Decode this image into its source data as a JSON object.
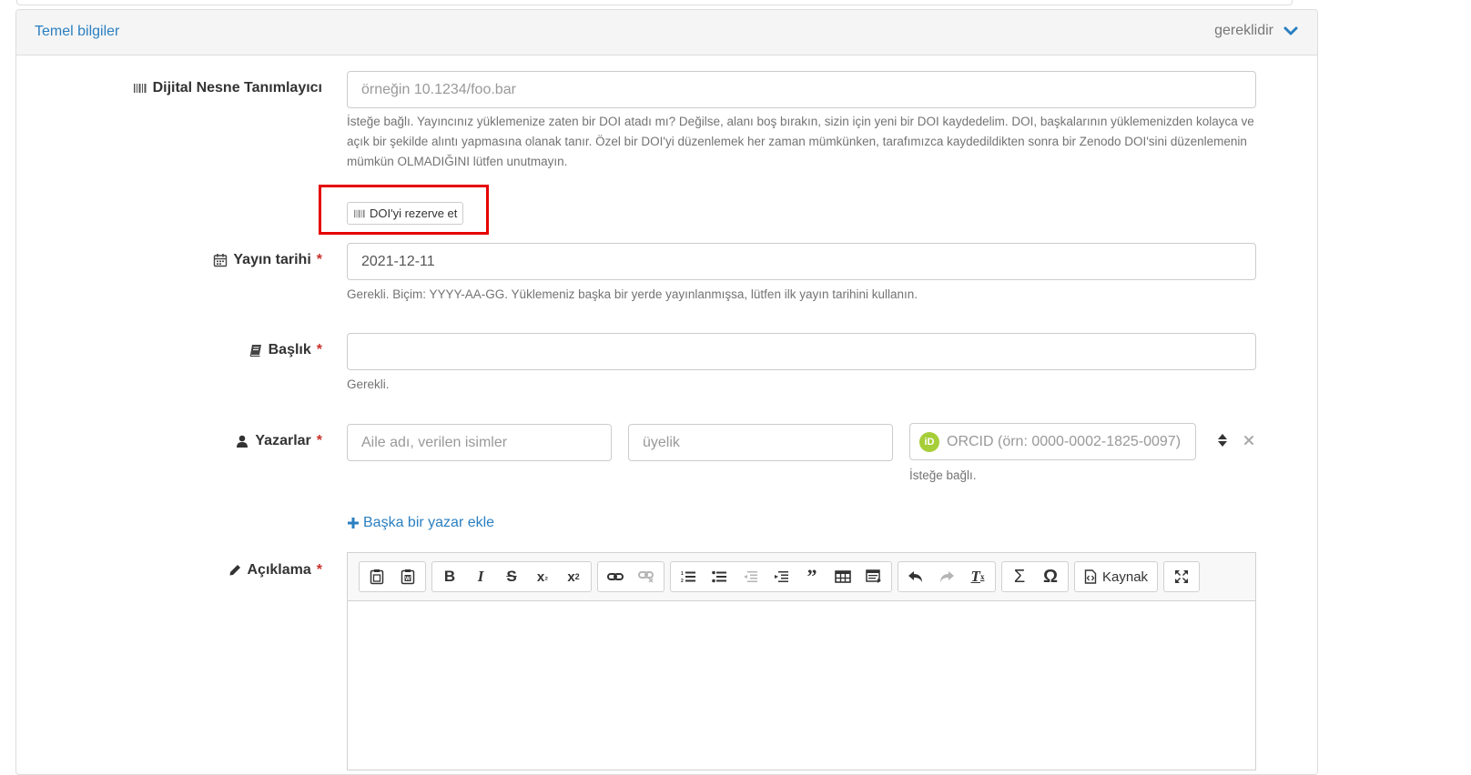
{
  "panel": {
    "title": "Temel bilgiler",
    "required_label": "gereklidir"
  },
  "doi": {
    "label": "Dijital Nesne Tanımlayıcı",
    "placeholder": "örneğin 10.1234/foo.bar",
    "help": "İsteğe bağlı. Yayıncınız yüklemenize zaten bir DOI atadı mı? Değilse, alanı boş bırakın, sizin için yeni bir DOI kaydedelim. DOI, başkalarının yüklemenizden kolayca ve açık bir şekilde alıntı yapmasına olanak tanır. Özel bir DOI'yi düzenlemek her zaman mümkünken, tarafımızca kaydedildikten sonra bir Zenodo DOI'sini düzenlemenin mümkün OLMADIĞINI lütfen unutmayın.",
    "reserve_button": "DOI'yi rezerve et"
  },
  "pubdate": {
    "label": "Yayın tarihi",
    "required_mark": "*",
    "value": "2021-12-11",
    "help": "Gerekli. Biçim: YYYY-AA-GG. Yüklemeniz başka bir yerde yayınlanmışsa, lütfen ilk yayın tarihini kullanın."
  },
  "title": {
    "label": "Başlık",
    "required_mark": "*",
    "value": "",
    "help": "Gerekli."
  },
  "authors": {
    "label": "Yazarlar",
    "required_mark": "*",
    "name_placeholder": "Aile adı, verilen isimler",
    "affiliation_placeholder": "üyelik",
    "orcid_placeholder": "ORCID (örn: 0000-0002-1825-0097)",
    "orcid_badge": "iD",
    "orcid_help": "İsteğe bağlı.",
    "add_label": "Başka bir yazar ekle"
  },
  "description": {
    "label": "Açıklama",
    "required_mark": "*",
    "source_label": "Kaynak"
  },
  "toolbar_icons": [
    "paste-icon",
    "paste-from-word-icon",
    "bold-icon",
    "italic-icon",
    "strike-icon",
    "subscript-icon",
    "superscript-icon",
    "link-icon",
    "unlink-icon",
    "numbered-list-icon",
    "bulleted-list-icon",
    "outdent-icon",
    "indent-icon",
    "blockquote-icon",
    "table-icon",
    "template-icon",
    "undo-icon",
    "redo-icon",
    "remove-format-icon",
    "sum-icon",
    "omega-icon",
    "source-icon",
    "maximize-icon"
  ],
  "colors": {
    "link": "#2a7fc1",
    "required": "#c9302c",
    "highlight": "#e60000",
    "orcid": "#a6ce39"
  }
}
